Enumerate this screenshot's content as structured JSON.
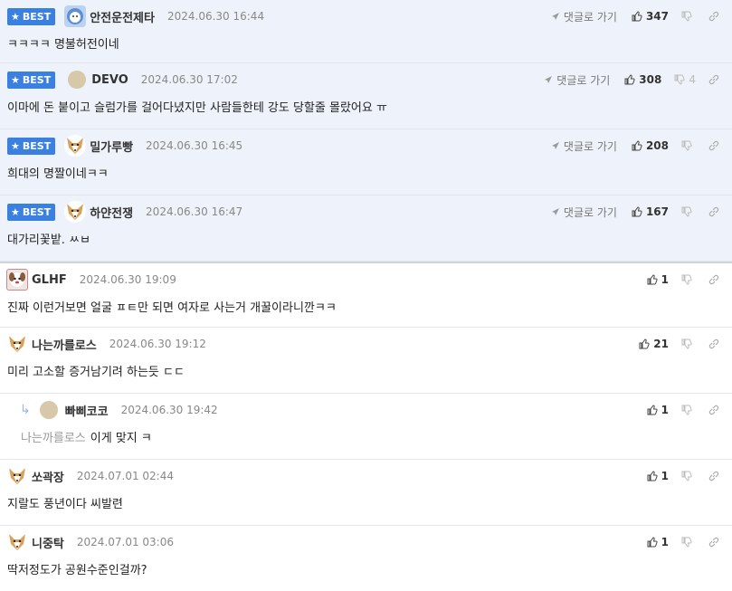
{
  "labels": {
    "best": "BEST",
    "reply": "댓글로 가기"
  },
  "comments": [
    {
      "best": true,
      "nick": "안전운전제타",
      "date": "2024.06.30 16:44",
      "text": "ㅋㅋㅋㅋ 명불허전이네",
      "up": "347",
      "down": "",
      "avatar": "ghost-avatar"
    },
    {
      "best": true,
      "nick": "DEVO",
      "date": "2024.06.30 17:02",
      "text": "이마에 돈 붙이고 슬럼가를 걸어다녔지만 사람들한테 강도 당할줄 몰랐어요 ㅠ",
      "up": "308",
      "down": "4",
      "avatar": "dot-avatar"
    },
    {
      "best": true,
      "nick": "밀가루빵",
      "date": "2024.06.30 16:45",
      "text": "희대의 명짤이네ㅋㅋ",
      "up": "208",
      "down": "",
      "avatar": "fox-avatar"
    },
    {
      "best": true,
      "nick": "하얀전쟁",
      "date": "2024.06.30 16:47",
      "text": "대가리꽃밭. ㅆㅂ",
      "up": "167",
      "down": "",
      "avatar": "fox-avatar"
    },
    {
      "best": false,
      "nick": "GLHF",
      "date": "2024.06.30 19:09",
      "text": "진짜 이런거보면 얼굴 ㅍㅌ만 되면 여자로 사는거 개꿀이라니깐ㅋㅋ",
      "up": "1",
      "down": "",
      "avatar": "dog-avatar"
    },
    {
      "best": false,
      "nick": "나는까를로스",
      "date": "2024.06.30 19:12",
      "text": "미리 고소할 증거남기려 하는듯 ㄷㄷ",
      "up": "21",
      "down": "",
      "avatar": "fox-avatar"
    },
    {
      "best": false,
      "reply": true,
      "nick": "빠삐코코",
      "date": "2024.06.30 19:42",
      "mention": "나는까를로스",
      "text": "이게 맞지 ㅋ",
      "up": "1",
      "down": "",
      "avatar": "dot-avatar"
    },
    {
      "best": false,
      "nick": "쏘곽장",
      "date": "2024.07.01 02:44",
      "text": "지랄도 풍년이다 씨발련",
      "up": "1",
      "down": "",
      "avatar": "fox-avatar"
    },
    {
      "best": false,
      "nick": "니중탁",
      "date": "2024.07.01 03:06",
      "text": "딱저정도가 공원수준인걸까?",
      "up": "1",
      "down": "",
      "avatar": "fox-avatar"
    }
  ]
}
